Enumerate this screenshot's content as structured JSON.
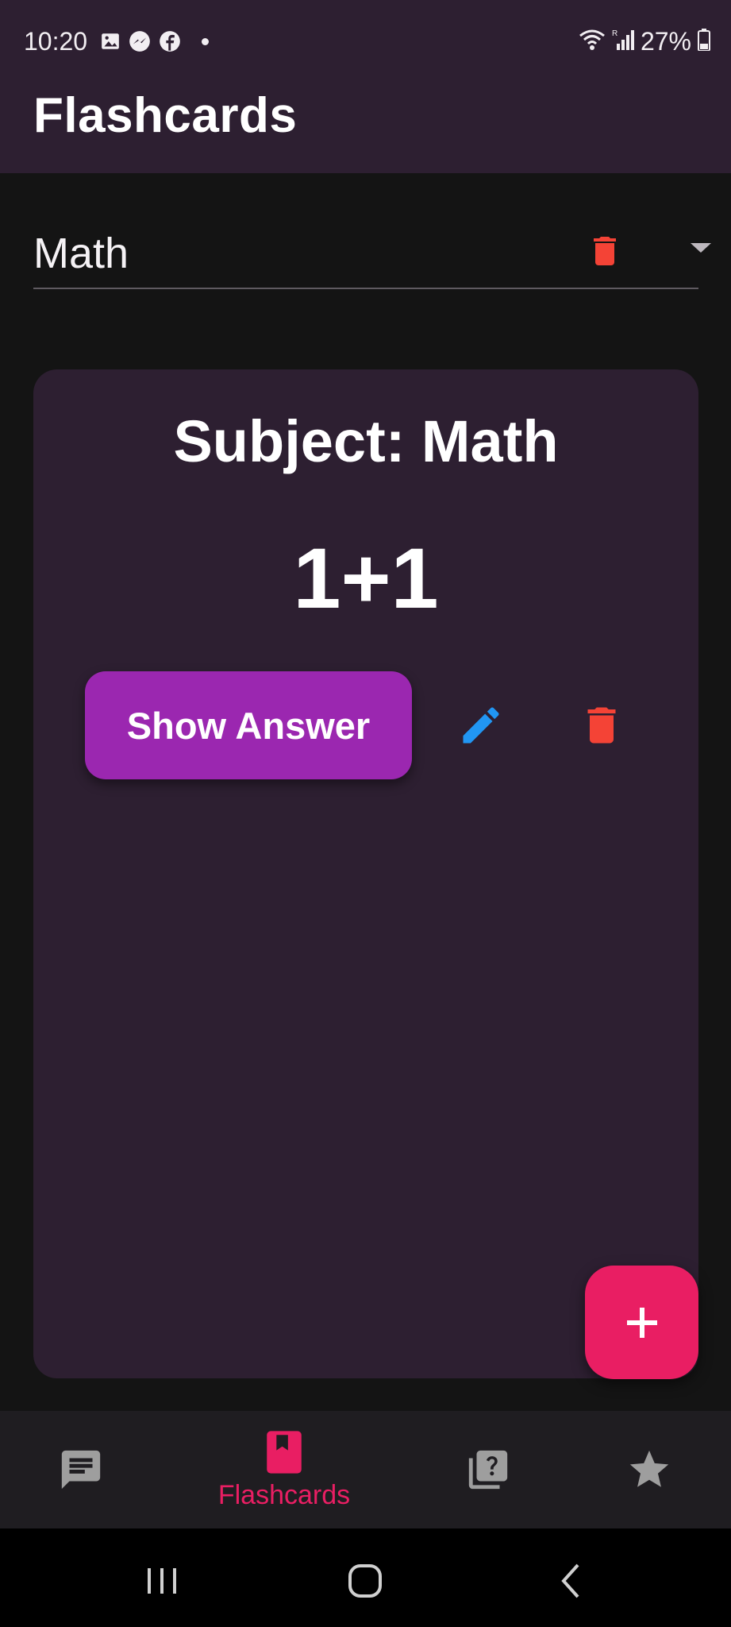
{
  "status_bar": {
    "time": "10:20",
    "battery": "27%",
    "notification_icons": [
      "gallery-icon",
      "messenger-icon",
      "facebook-icon",
      "dot-icon"
    ],
    "system_icons": [
      "wifi-icon",
      "signal-icon",
      "battery-icon"
    ]
  },
  "app_bar": {
    "title": "Flashcards"
  },
  "subject_selector": {
    "value": "Math",
    "delete_icon": "trash-icon",
    "dropdown_icon": "caret-down-icon"
  },
  "card": {
    "subject": "Subject: Math",
    "question": "1+1",
    "show_answer_label": "Show Answer",
    "edit_icon": "pencil-icon",
    "delete_icon": "trash-icon"
  },
  "fab": {
    "icon": "plus-icon"
  },
  "bottom_nav": {
    "items": [
      {
        "icon": "chat-icon",
        "label": "",
        "active": false
      },
      {
        "icon": "bookmark-card-icon",
        "label": "Flashcards",
        "active": true
      },
      {
        "icon": "quiz-icon",
        "label": "",
        "active": false
      },
      {
        "icon": "star-icon",
        "label": "",
        "active": false
      }
    ]
  },
  "colors": {
    "app_bar_bg": "#2d1f31",
    "background": "#141414",
    "card_bg": "#2d1f31",
    "primary_button": "#9b27b0",
    "accent": "#e91e63",
    "delete_red": "#f44336",
    "edit_blue": "#2196f3",
    "inactive_icon": "#9e9e9e"
  }
}
